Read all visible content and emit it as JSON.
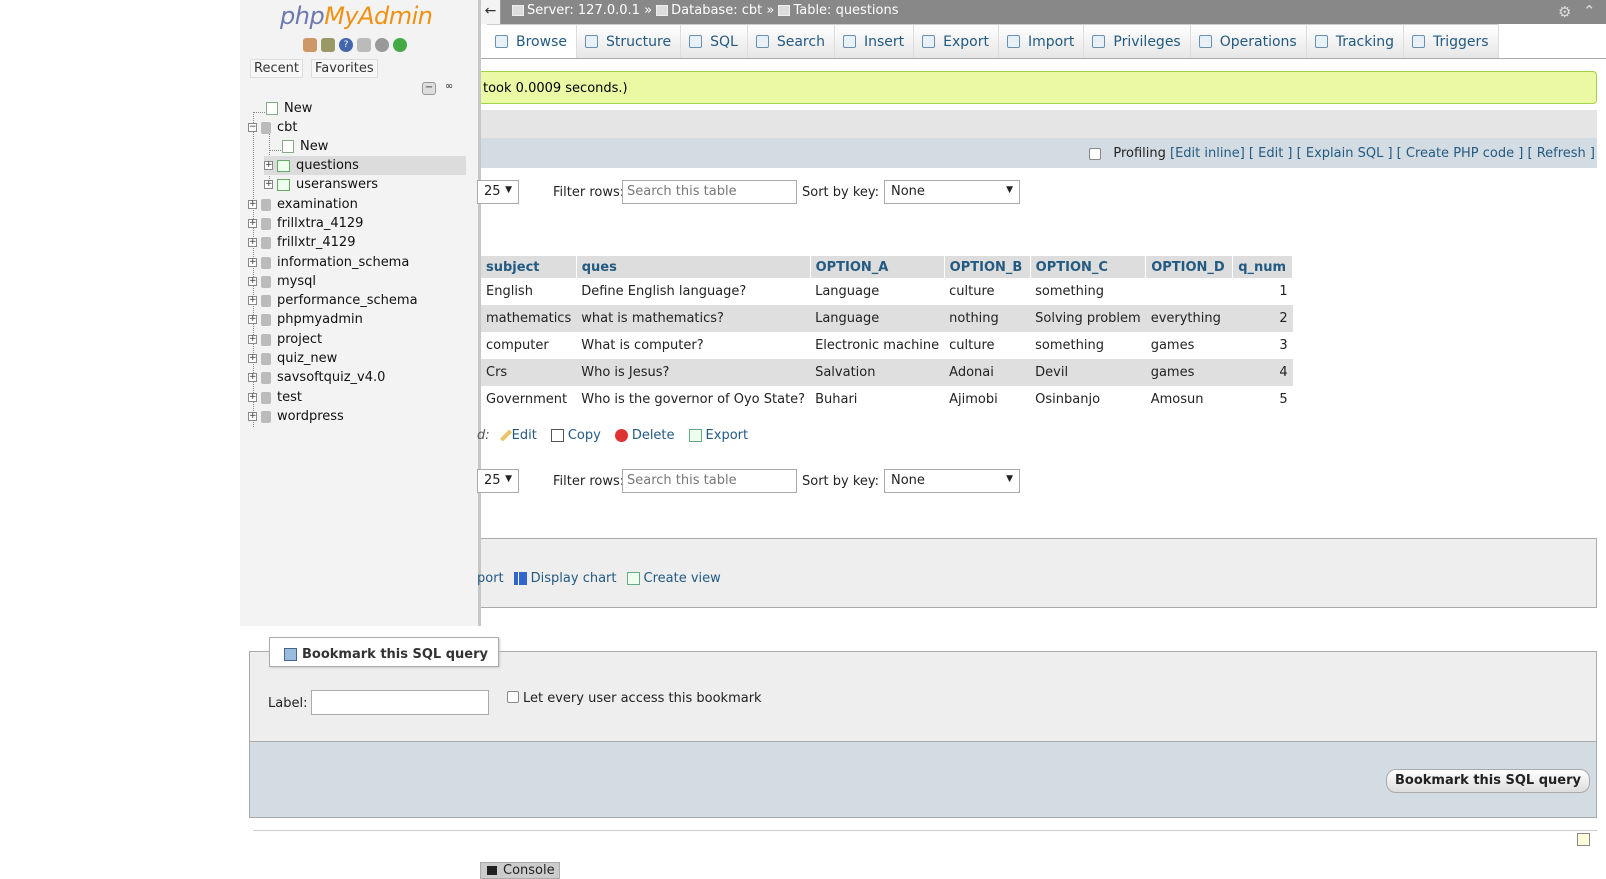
{
  "sidebar": {
    "logo_php": "php",
    "logo_myadmin": "MyAdmin",
    "tabs": [
      "Recent",
      "Favorites"
    ],
    "tree": [
      {
        "label": "New",
        "type": "new",
        "level": 0
      },
      {
        "label": "cbt",
        "type": "db",
        "level": 0,
        "expanded": true
      },
      {
        "label": "New",
        "type": "new",
        "level": 1
      },
      {
        "label": "questions",
        "type": "table",
        "level": 1,
        "selected": true
      },
      {
        "label": "useranswers",
        "type": "table",
        "level": 1
      },
      {
        "label": "examination",
        "type": "db",
        "level": 0
      },
      {
        "label": "frillxtra_4129",
        "type": "db",
        "level": 0
      },
      {
        "label": "frillxtr_4129",
        "type": "db",
        "level": 0
      },
      {
        "label": "information_schema",
        "type": "db",
        "level": 0
      },
      {
        "label": "mysql",
        "type": "db",
        "level": 0
      },
      {
        "label": "performance_schema",
        "type": "db",
        "level": 0
      },
      {
        "label": "phpmyadmin",
        "type": "db",
        "level": 0
      },
      {
        "label": "project",
        "type": "db",
        "level": 0
      },
      {
        "label": "quiz_new",
        "type": "db",
        "level": 0
      },
      {
        "label": "savsoftquiz_v4.0",
        "type": "db",
        "level": 0
      },
      {
        "label": "test",
        "type": "db",
        "level": 0
      },
      {
        "label": "wordpress",
        "type": "db",
        "level": 0
      }
    ]
  },
  "breadcrumb": {
    "server": "Server: 127.0.0.1 »",
    "database": "Database: cbt »",
    "table": "Table: questions"
  },
  "tabs": [
    "Browse",
    "Structure",
    "SQL",
    "Search",
    "Insert",
    "Export",
    "Import",
    "Privileges",
    "Operations",
    "Tracking",
    "Triggers"
  ],
  "active_tab": "Browse",
  "success_message": "took 0.0009 seconds.)",
  "profiling": {
    "label": "Profiling",
    "links": [
      "[Edit inline]",
      "[ Edit ]",
      "[ Explain SQL ]",
      "[ Create PHP code ]",
      "[ Refresh ]"
    ]
  },
  "nav": {
    "rows_value": "25",
    "filter_label": "Filter rows:",
    "filter_placeholder": "Search this table",
    "sort_label": "Sort by key:",
    "sort_value": "None"
  },
  "table": {
    "columns": [
      "subject",
      "ques",
      "OPTION_A",
      "OPTION_B",
      "OPTION_C",
      "OPTION_D",
      "q_num"
    ],
    "rows": [
      [
        "English",
        "Define English language?",
        "Language",
        "culture",
        "something",
        "",
        "1"
      ],
      [
        "mathematics",
        "what is mathematics?",
        "Language",
        "nothing",
        "Solving problem",
        "everything",
        "2"
      ],
      [
        "computer",
        "What is computer?",
        "Electronic machine",
        "culture",
        "something",
        "games",
        "3"
      ],
      [
        "Crs",
        "Who is Jesus?",
        "Salvation",
        "Adonai",
        "Devil",
        "games",
        "4"
      ],
      [
        "Government",
        "Who is the governor of Oyo State?",
        "Buhari",
        "Ajimobi",
        "Osinbanjo",
        "Amosun",
        "5"
      ]
    ]
  },
  "actions": {
    "prefix": "d:",
    "edit": "Edit",
    "copy": "Copy",
    "delete": "Delete",
    "export": "Export"
  },
  "query_ops": {
    "export": "port",
    "display_chart": "Display chart",
    "create_view": "Create view"
  },
  "bookmark": {
    "legend": "Bookmark this SQL query",
    "label": "Label:",
    "checkbox_label": "Let every user access this bookmark",
    "button": "Bookmark this SQL query"
  },
  "console": "Console"
}
